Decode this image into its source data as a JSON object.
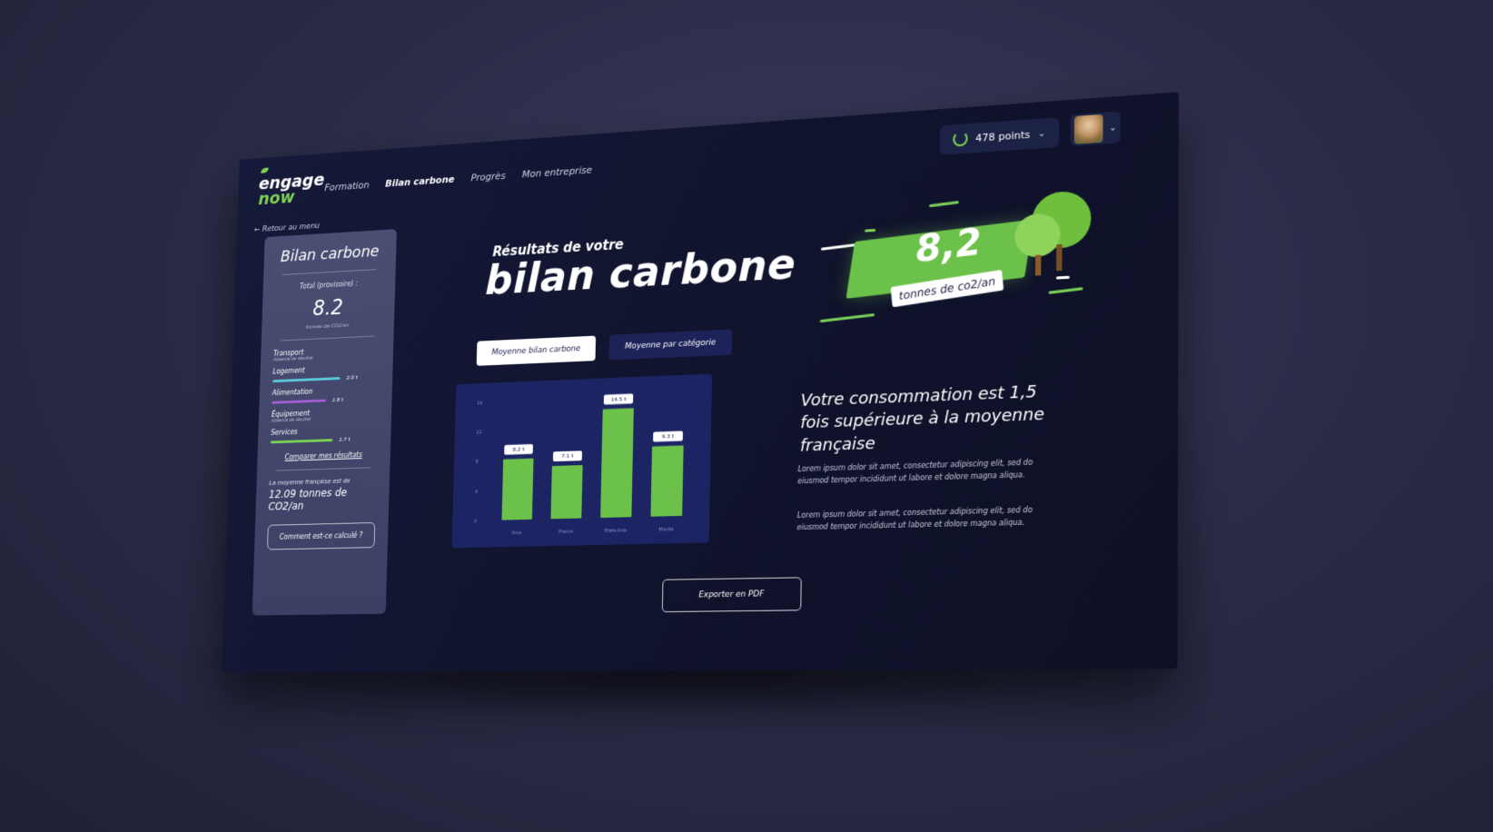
{
  "logo": {
    "line1": "engage",
    "line2": "now"
  },
  "nav": {
    "items": [
      "Formation",
      "Bilan carbone",
      "Progrès",
      "Mon entreprise"
    ],
    "active": "Bilan carbone"
  },
  "user": {
    "points": "478 points"
  },
  "sidebar": {
    "back": "← Retour au menu",
    "title": "Bilan carbone",
    "total_label": "Total (provisoire) :",
    "total_value": "8.2",
    "total_unit": "tonnes de CO2/an",
    "categories": [
      {
        "name": "Transport",
        "sub": "Absence de résultat",
        "value": "",
        "fill": 0,
        "color": ""
      },
      {
        "name": "Logement",
        "sub": "",
        "value": "2.0 t",
        "fill": 0.85,
        "color": "#5ac8d8"
      },
      {
        "name": "Alimentation",
        "sub": "",
        "value": "1.8 t",
        "fill": 0.68,
        "color": "#a35ed3"
      },
      {
        "name": "Équipement",
        "sub": "Absence de résultat",
        "value": "",
        "fill": 0,
        "color": ""
      },
      {
        "name": "Services",
        "sub": "",
        "value": "1.7 t",
        "fill": 0.78,
        "color": "#7bd157"
      }
    ],
    "compare_link": "Comparer mes résultats",
    "avg_label": "La moyenne française est de",
    "avg_value": "12.09 tonnes de CO2/an",
    "how_button": "Comment est-ce calculé ?"
  },
  "main": {
    "pre_title": "Résultats de votre",
    "title": "bilan carbone",
    "tabs": [
      "Moyenne bilan carbone",
      "Moyenne par catégorie"
    ],
    "score": "8,2",
    "score_unit": "tonnes de co2/an",
    "consumption": "Votre consommation est 1,5 fois supérieure à la moyenne française",
    "lorem1": "Lorem ipsum dolor sit amet, consectetur adipiscing elit, sed do eiusmod tempor incididunt ut labore et dolore magna aliqua.",
    "lorem2": "Lorem ipsum dolor sit amet, consectetur adipiscing elit, sed do eiusmod tempor incididunt ut labore et dolore magna aliqua.",
    "export_button": "Exporter en PDF"
  },
  "colors": {
    "accent": "#7bd157",
    "background": "#10132c",
    "card": "#1c2464"
  },
  "chart_data": {
    "type": "bar",
    "categories": [
      "Vous",
      "France",
      "Etats-Unis",
      "Monde"
    ],
    "values": [
      8.2,
      7.1,
      14.5,
      9.3
    ],
    "data_labels": [
      "8.2 t",
      "7.1 t",
      "14.5 t",
      "9.3 t"
    ],
    "yticks": [
      0,
      4,
      8,
      12,
      16
    ],
    "ylim": [
      0,
      16
    ],
    "bar_color": "#6cc14a",
    "title": "",
    "xlabel": "",
    "ylabel": ""
  }
}
